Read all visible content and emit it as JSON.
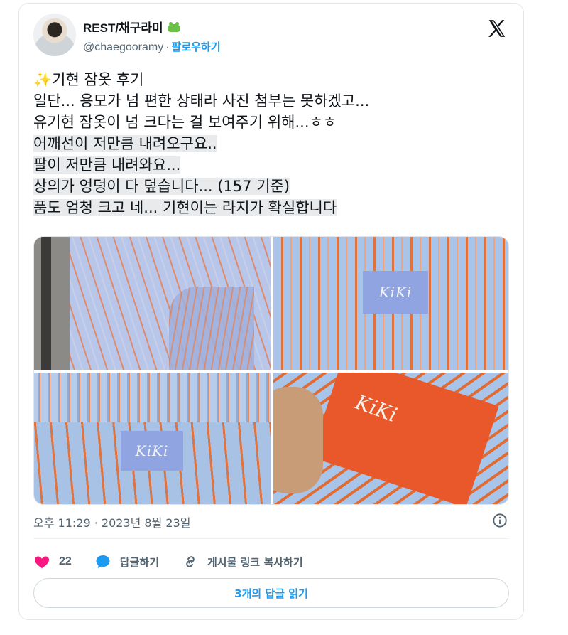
{
  "author": {
    "display_name": "REST/채구라미",
    "emoji": "frog",
    "handle": "@chaegooramy",
    "separator": "·",
    "follow_label": "팔로우하기"
  },
  "tweet": {
    "lines": [
      "기현 잠옷 후기",
      "일단... 용모가 넘 편한 상태라 사진 첨부는 못하겠고...",
      "유기현 잠옷이 넘 크다는 걸 보여주기 위해...ㅎㅎ",
      "어깨선이 저만큼 내려오구요..",
      "팔이 저만큼 내려와요...",
      "상의가 엉덩이 다 덮습니다... (157 기준)",
      "품도 엄청 크고 네... 기현이는 라지가 확실합니다"
    ],
    "title_emoji": "✨"
  },
  "photos": {
    "label_text_1": "KiKi",
    "label_text_2": "KiKi",
    "signature_text": "KiKi"
  },
  "meta": {
    "timestamp": "오후 11:29 · 2023년 8월 23일"
  },
  "actions": {
    "like_count": "22",
    "reply_label": "답글하기",
    "copy_link_label": "게시물 링크 복사하기"
  },
  "read_replies_label": "3개의 답글 읽기",
  "colors": {
    "accent": "#1d9bf0",
    "like": "#f91880",
    "reply_bubble": "#1d9bf0",
    "text": "#0f1419",
    "muted": "#536471"
  }
}
